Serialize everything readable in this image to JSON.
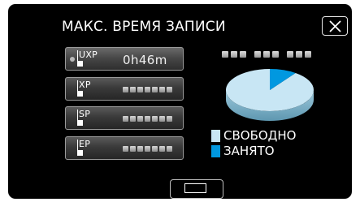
{
  "header": {
    "title": "МАКС. ВРЕМЯ ЗАПИСИ"
  },
  "modes": [
    {
      "label": "UXP",
      "value": "0h46m",
      "selected": true
    },
    {
      "label": "XP",
      "value": "",
      "selected": false
    },
    {
      "label": "SP",
      "value": "",
      "selected": false
    },
    {
      "label": "EP",
      "value": "",
      "selected": false
    }
  ],
  "legend": {
    "free_label": "СВОБОДНО",
    "used_label": "ЗАНЯТО"
  },
  "usage": {
    "used_fraction": 0.1,
    "free_fraction": 0.9
  },
  "colors": {
    "free": "#c8e6f4",
    "used": "#0098e0"
  },
  "icons": {
    "close": "close-x-icon",
    "bottom": "screen-toggle-icon"
  }
}
